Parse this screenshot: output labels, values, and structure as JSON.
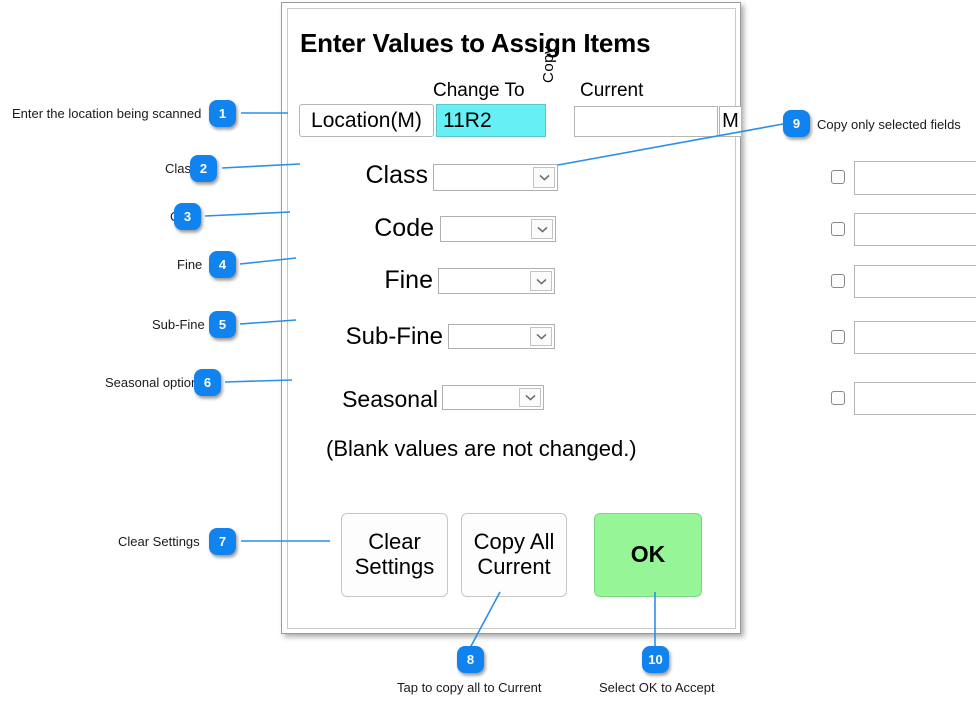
{
  "dialog": {
    "title": "Enter Values to Assign Items",
    "headers": {
      "change_to": "Change To",
      "current": "Current",
      "copy": "Copy"
    },
    "location_row": {
      "label": "Location(M)",
      "change_to_value": "11R2",
      "change_to_bg": "#66f0f5",
      "current_value": "",
      "m_button_label": "M"
    },
    "rows": [
      {
        "label": "Class",
        "select_value": "",
        "checked": false,
        "current_value": ""
      },
      {
        "label": "Code",
        "select_value": "",
        "checked": false,
        "current_value": ""
      },
      {
        "label": "Fine",
        "select_value": "",
        "checked": false,
        "current_value": ""
      },
      {
        "label": "Sub-Fine",
        "select_value": "",
        "checked": false,
        "current_value": ""
      },
      {
        "label": "Seasonal",
        "select_value": "",
        "checked": false,
        "current_value": ""
      }
    ],
    "note": "(Blank values are not changed.)",
    "buttons": {
      "clear_settings": "Clear\nSettings",
      "clear_settings_line1": "Clear",
      "clear_settings_line2": "Settings",
      "copy_all_line1": "Copy All",
      "copy_all_line2": "Current",
      "ok": "OK",
      "ok_color": "#96f597"
    }
  },
  "annotations": {
    "accent_color": "#1183ee",
    "items": [
      {
        "number": "1",
        "text": "Enter the location being scanned"
      },
      {
        "number": "2",
        "text": "Class"
      },
      {
        "number": "3",
        "text": "Code"
      },
      {
        "number": "4",
        "text": "Fine"
      },
      {
        "number": "5",
        "text": "Sub-Fine"
      },
      {
        "number": "6",
        "text": "Seasonal option"
      },
      {
        "number": "7",
        "text": "Clear Settings"
      },
      {
        "number": "8",
        "text": "Tap to copy all to Current"
      },
      {
        "number": "9",
        "text": "Copy only selected fields"
      },
      {
        "number": "10",
        "text": "Select OK to Accept"
      }
    ]
  }
}
